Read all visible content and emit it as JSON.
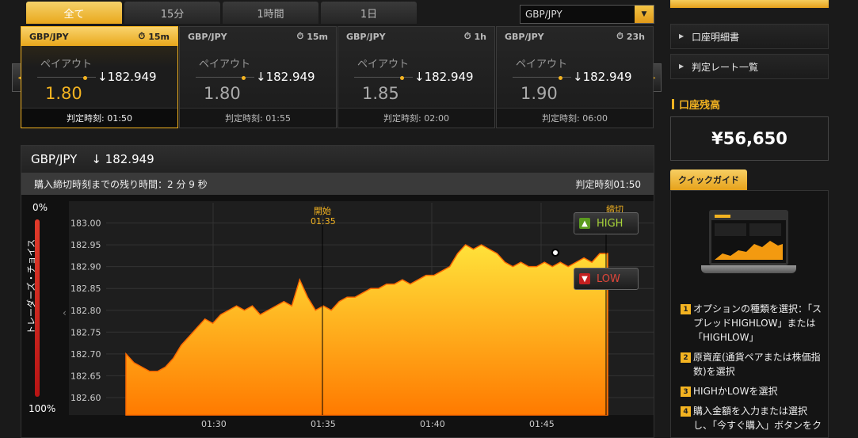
{
  "tabs": [
    {
      "label": "全て",
      "active": true
    },
    {
      "label": "15分",
      "active": false
    },
    {
      "label": "1時間",
      "active": false
    },
    {
      "label": "1日",
      "active": false
    }
  ],
  "pair_select": {
    "value": "GBP/JPY"
  },
  "cards": [
    {
      "pair": "GBP/JPY",
      "duration": "15m",
      "payout_label": "ペイアウト",
      "payout": "1.80",
      "rate": "↓182.949",
      "expiry": "判定時刻: 01:50",
      "active": true
    },
    {
      "pair": "GBP/JPY",
      "duration": "15m",
      "payout_label": "ペイアウト",
      "payout": "1.80",
      "rate": "↓182.949",
      "expiry": "判定時刻: 01:55",
      "active": false
    },
    {
      "pair": "GBP/JPY",
      "duration": "1h",
      "payout_label": "ペイアウト",
      "payout": "1.85",
      "rate": "↓182.949",
      "expiry": "判定時刻: 02:00",
      "active": false
    },
    {
      "pair": "GBP/JPY",
      "duration": "23h",
      "payout_label": "ペイアウト",
      "payout": "1.90",
      "rate": "↓182.949",
      "expiry": "判定時刻: 06:00",
      "active": false
    }
  ],
  "chart_panel": {
    "pair": "GBP/JPY",
    "rate": "↓ 182.949",
    "remaining": "購入締切時刻までの残り時間：2 分 9 秒",
    "expiry": "判定時刻01:50",
    "traders_choice_label": "トレーダーズ・チョイス",
    "traders_choice_top": "0%",
    "traders_choice_bottom": "100%",
    "high_label": "HIGH",
    "low_label": "LOW",
    "start_marker": [
      "開始",
      "01:35"
    ],
    "close_marker": "締切"
  },
  "chart_data": {
    "type": "area",
    "x_ticks": [
      "01:30",
      "01:35",
      "01:40",
      "01:45"
    ],
    "y_ticks": [
      183.0,
      182.95,
      182.9,
      182.85,
      182.8,
      182.75,
      182.7,
      182.65,
      182.6
    ],
    "ylim": [
      182.56,
      183.05
    ],
    "x_range_minutes": [
      -1.3,
      3.4,
      8.4,
      10.0
    ],
    "x": [
      0,
      0.25,
      0.5,
      0.75,
      1.0,
      1.25,
      1.5,
      1.75,
      2.0,
      2.25,
      2.5,
      2.75,
      3.0,
      3.25,
      3.5,
      3.75,
      4.0,
      4.25,
      4.5,
      4.75,
      5.0,
      5.25,
      5.5,
      5.75,
      6.0,
      6.25,
      6.5,
      6.75,
      7.0,
      7.25,
      7.5,
      7.75,
      8.0,
      8.25,
      8.5,
      8.75,
      9.0,
      9.25,
      9.5,
      9.75,
      10.0,
      10.25,
      10.5,
      10.75,
      11.0,
      11.25,
      11.5,
      11.75,
      12.0,
      12.25,
      12.5,
      12.75,
      13.0,
      13.25,
      13.5,
      13.75,
      14.0,
      14.25,
      14.5,
      14.75,
      15.0,
      15.25
    ],
    "values": [
      182.7,
      182.68,
      182.67,
      182.66,
      182.66,
      182.67,
      182.69,
      182.72,
      182.74,
      182.76,
      182.78,
      182.77,
      182.79,
      182.8,
      182.81,
      182.8,
      182.81,
      182.79,
      182.8,
      182.81,
      182.82,
      182.81,
      182.87,
      182.83,
      182.8,
      182.81,
      182.8,
      182.82,
      182.83,
      182.83,
      182.84,
      182.85,
      182.85,
      182.86,
      182.86,
      182.87,
      182.86,
      182.87,
      182.88,
      182.88,
      182.89,
      182.9,
      182.93,
      182.95,
      182.94,
      182.95,
      182.94,
      182.93,
      182.91,
      182.9,
      182.91,
      182.9,
      182.9,
      182.91,
      182.9,
      182.91,
      182.9,
      182.91,
      182.92,
      182.91,
      182.93,
      182.93
    ],
    "current_value": 182.949,
    "grid": true
  },
  "sidebar": {
    "links": [
      "口座明細書",
      "判定レート一覧"
    ],
    "balance_title": "口座残高",
    "balance": "¥56,650",
    "quick_guide_tab": "クイックガイド",
    "steps": [
      {
        "num": "1",
        "text": "オプションの種類を選択：「スプレッドHIGHLOW」または「HIGHLOW」"
      },
      {
        "num": "2",
        "text": "原資産(通貨ペアまたは株価指数)を選択"
      },
      {
        "num": "3",
        "text": "HIGHかLOWを選択"
      },
      {
        "num": "4",
        "text": "購入金額を入力または選択し、「今すぐ購入」ボタンをク"
      }
    ]
  },
  "colors": {
    "accent": "#f3b321",
    "high": "#a8d43a",
    "low": "#e0463a"
  }
}
